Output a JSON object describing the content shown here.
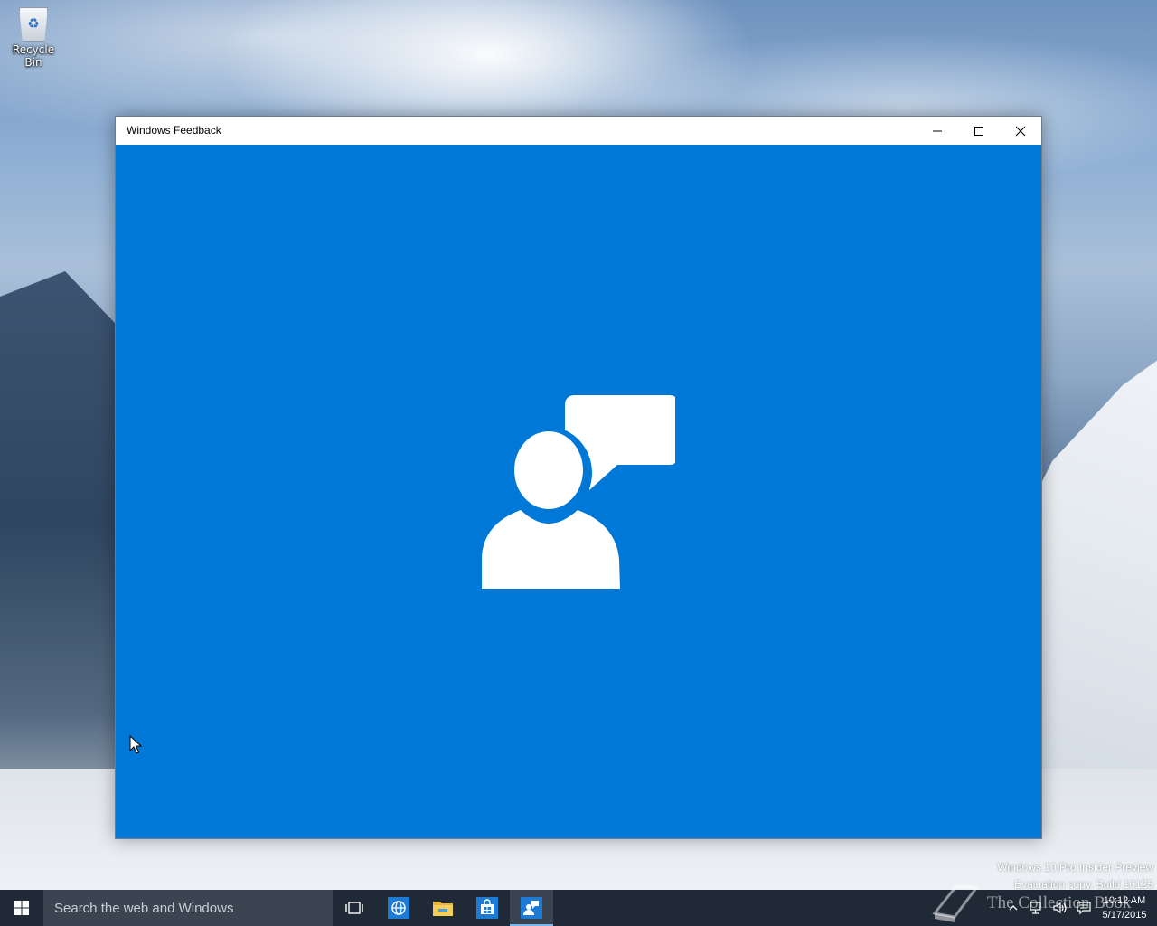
{
  "desktop": {
    "icons": [
      {
        "label": "Recycle Bin",
        "icon": "recycle-bin-icon"
      }
    ],
    "watermark": {
      "line1": "Windows 10 Pro Insider Preview",
      "line2": "Evaluation copy. Build 10125"
    }
  },
  "window": {
    "title": "Windows Feedback",
    "controls": {
      "minimize": "minimize-icon",
      "maximize": "maximize-icon",
      "close": "close-icon"
    },
    "background_color": "#0078d7",
    "splash_icon": "feedback-person-speech-icon"
  },
  "taskbar": {
    "search_placeholder": "Search the web and Windows",
    "pinned": [
      "task-view-icon",
      "internet-explorer-icon",
      "file-explorer-icon",
      "store-icon",
      "windows-feedback-icon"
    ],
    "active_app": "windows-feedback-icon",
    "tray": {
      "brand_text": "The Collection Book",
      "time": "10:12 AM",
      "date": "5/17/2015"
    }
  },
  "colors": {
    "accent": "#0078d7",
    "taskbar": "#1f2a36",
    "search_box": "#3b4551"
  }
}
